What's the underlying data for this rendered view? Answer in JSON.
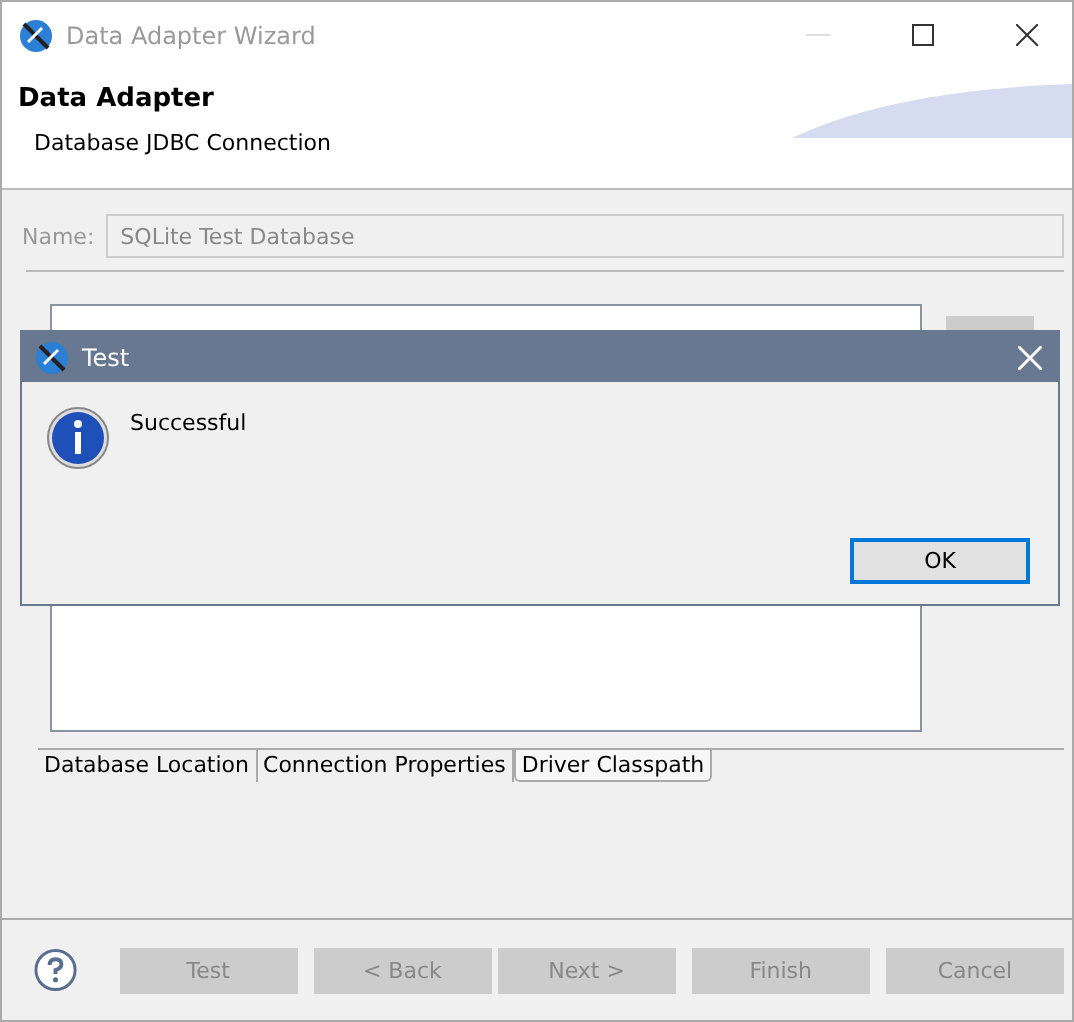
{
  "window": {
    "title": "Data Adapter Wizard"
  },
  "header": {
    "title": "Data Adapter",
    "subtitle": "Database JDBC Connection"
  },
  "name_field": {
    "label": "Name:",
    "value": "SQLite Test Database",
    "disabled": true
  },
  "tabs": [
    {
      "label": "Database Location",
      "selected": false
    },
    {
      "label": "Connection Properties",
      "selected": false
    },
    {
      "label": "Driver Classpath",
      "selected": true
    }
  ],
  "buttons": [
    {
      "label": "Test",
      "disabled": true
    },
    {
      "label": "< Back",
      "disabled": true
    },
    {
      "label": "Next >",
      "disabled": true
    },
    {
      "label": "Finish",
      "disabled": true
    },
    {
      "label": "Cancel",
      "disabled": true
    }
  ],
  "dialog": {
    "title": "Test",
    "message": "Successful",
    "button": "OK"
  }
}
